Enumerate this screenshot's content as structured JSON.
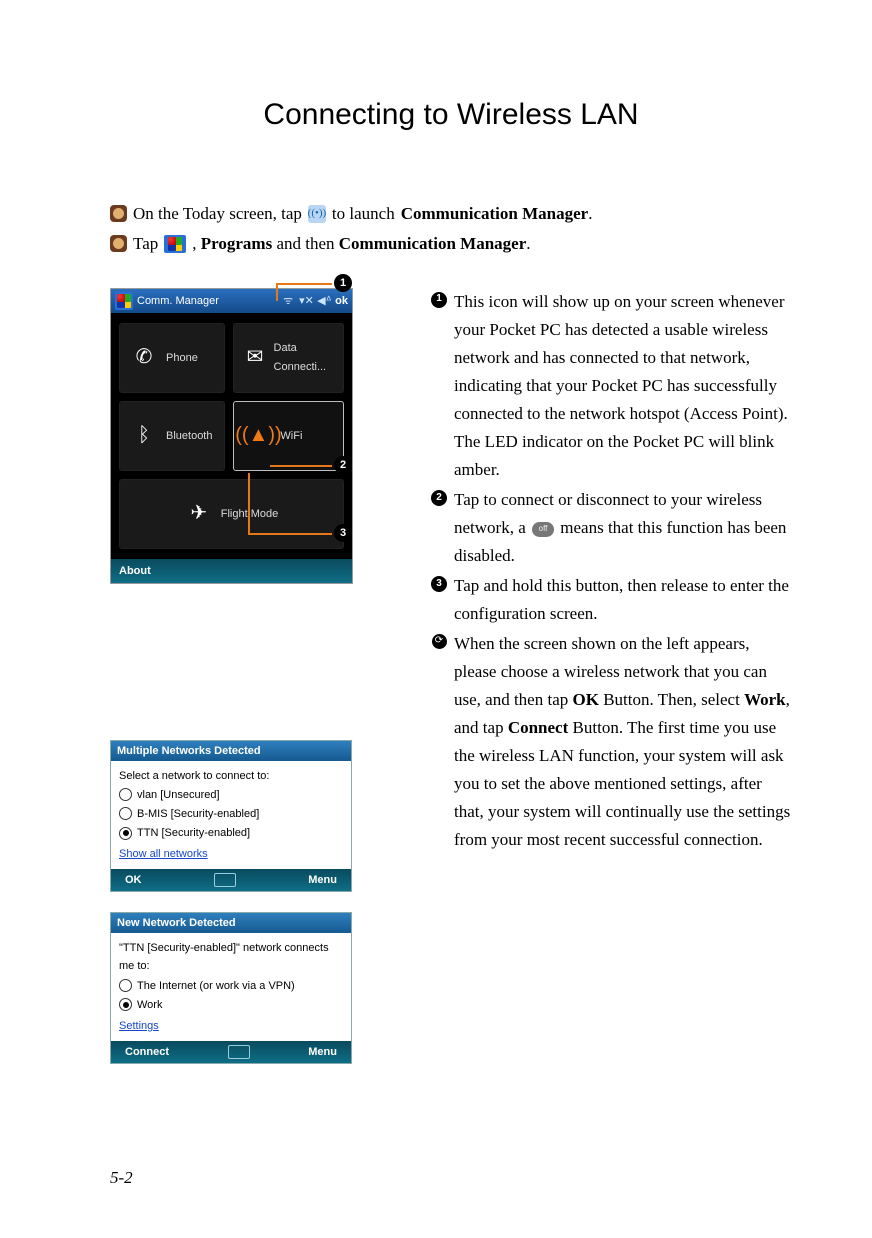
{
  "title": "Connecting to Wireless LAN",
  "intro1": {
    "a": "On the Today screen, tap",
    "b": "to launch",
    "c": "Communication Manager",
    "d": "."
  },
  "intro2": {
    "a": "Tap",
    "b": ",",
    "c": "Programs",
    "d": "and then",
    "e": "Communication Manager",
    "f": "."
  },
  "comm": {
    "title": "Comm. Manager",
    "ok": "ok",
    "phone": "Phone",
    "data": "Data Connecti...",
    "bluetooth": "Bluetooth",
    "wifi": "WiFi",
    "flight": "Flight Mode",
    "about": "About"
  },
  "popup1": {
    "hdr": "Multiple Networks Detected",
    "prompt": "Select a network to connect to:",
    "opts": [
      "vlan [Unsecured]",
      "B-MIS [Security-enabled]",
      "TTN [Security-enabled]"
    ],
    "link": "Show all networks",
    "ok": "OK",
    "menu": "Menu"
  },
  "popup2": {
    "hdr": "New Network Detected",
    "prompt": "\"TTN [Security-enabled]\" network connects me to:",
    "opts": [
      "The Internet (or work via a VPN)",
      "Work"
    ],
    "link": "Settings",
    "connect": "Connect",
    "menu": "Menu"
  },
  "right": {
    "n1": "This icon will show up on your screen whenever your Pocket PC has detected a usable wireless network and has connected to that network, indicating that your Pocket PC has successfully connected to the network hotspot (Access Point). The LED indicator on the Pocket PC will blink amber.",
    "n2a": "Tap to connect or disconnect to your wireless network, a",
    "n2b": "means that this function has been disabled.",
    "n3": "Tap and hold this button, then release to enter the configuration screen.",
    "n4a": "When the screen shown on the left appears, please choose a wireless network that you can use, and then tap",
    "n4b": "OK",
    "n4c": "Button. Then, select",
    "n4d": "Work",
    "n4e": ", and tap",
    "n4f": "Connect",
    "n4g": "Button. The first time you use the wireless LAN function, your system will ask you to set the above mentioned settings, after that, your system will continually use the settings from your most recent successful connection."
  },
  "off": "off",
  "pagenum": "5-2"
}
